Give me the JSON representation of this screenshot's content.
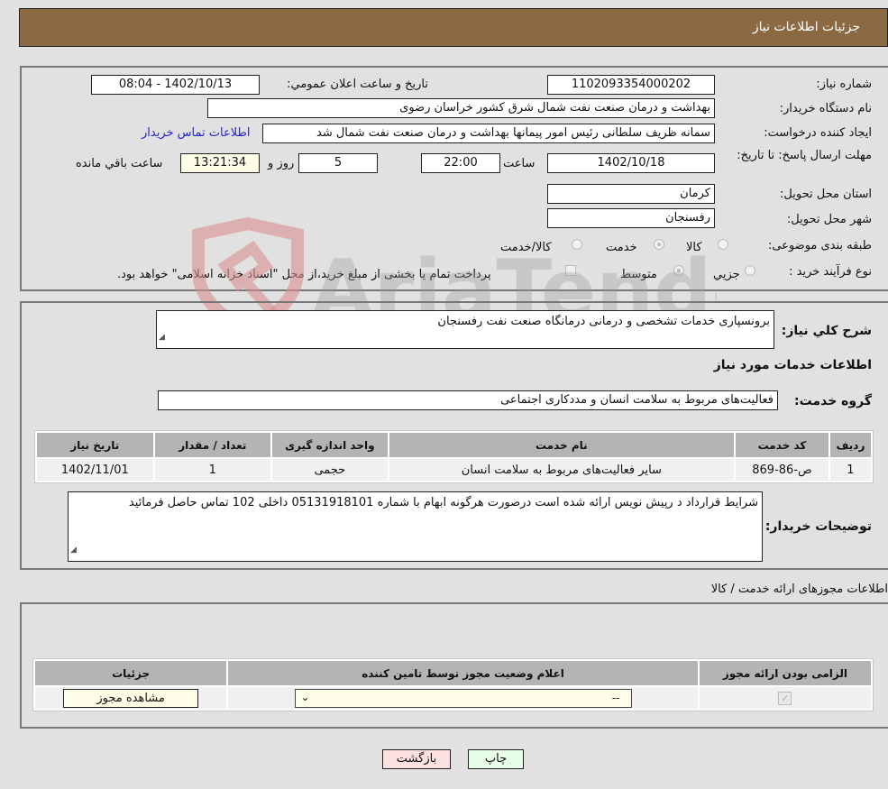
{
  "header": {
    "title": "جزئیات اطلاعات نیاز"
  },
  "form": {
    "need_number": {
      "label": "شماره نیاز:",
      "value": "1102093354000202"
    },
    "announce_datetime": {
      "label": "تاریخ و ساعت اعلان عمومي:",
      "value": "1402/10/13 - 08:04"
    },
    "buyer_org": {
      "label": "نام دستگاه خريدار:",
      "value": "بهداشت و درمان صنعت نفت شمال شرق کشور   خراسان رضوی"
    },
    "requester": {
      "label": "ايجاد کننده درخواست:",
      "value": "سمانه ظریف سلطانی رئیس امور پیمانها بهداشت و درمان صنعت نفت شمال شد"
    },
    "buyer_contact_link": "اطلاعات تماس خريدار",
    "deadline": {
      "label": "مهلت ارسال پاسخ: تا تاريخ:",
      "date": "1402/10/18",
      "time_label": "ساعت",
      "time": "22:00",
      "days": "5",
      "days_label": "روز و",
      "remaining": "13:21:34",
      "remaining_label": "ساعت باقي مانده"
    },
    "province": {
      "label": "استان محل تحويل:",
      "value": "کرمان"
    },
    "city": {
      "label": "شهر محل تحويل:",
      "value": "رفسنجان"
    },
    "category": {
      "label": "طبقه بندی موضوعی:",
      "options": [
        "کالا",
        "خدمت",
        "کالا/خدمت"
      ],
      "selected": "خدمت"
    },
    "purchase_type": {
      "label": "نوع فرآيند خريد :",
      "options": [
        "جزيي",
        "متوسط"
      ],
      "selected": "متوسط",
      "note": "پرداخت تمام يا بخشی از مبلغ خريد،از محل \"اسناد خزانه اسلامی\" خواهد بود."
    }
  },
  "description": {
    "label": "شرح کلي نياز:",
    "value": "برونسپاری خدمات تشخصی و درمانی درمانگاه صنعت نفت رفسنجان"
  },
  "services_section_title": "اطلاعات خدمات مورد نياز",
  "service_group": {
    "label": "گروه خدمت:",
    "value": "فعاليت‌های مربوط به سلامت انسان و مددکاری اجتماعی"
  },
  "services_table": {
    "headers": [
      "رديف",
      "کد خدمت",
      "نام خدمت",
      "واحد اندازه گيری",
      "تعداد / مقدار",
      "تاريخ نياز"
    ],
    "rows": [
      [
        "1",
        "ص-86-869",
        "ساير فعاليت‌های مربوط به سلامت انسان",
        "حجمی",
        "1",
        "1402/11/01"
      ]
    ]
  },
  "buyer_notes": {
    "label": "توضيحات خريدار:",
    "value": "شرایط قرارداد د رپیش نویس ارائه شده است درصورت هرگونه ابهام با شماره 05131918101 داخلی 102 تماس حاصل فرمائید"
  },
  "permits_section_title": "اطلاعات مجوزهای ارائه خدمت / کالا",
  "permits_table": {
    "headers": [
      "الزامی بودن ارائه مجوز",
      "اعلام وضعيت مجوز توسط تامين کننده",
      "جزئيات"
    ],
    "rows": [
      {
        "required": true,
        "status": "--",
        "details_button": "مشاهده مجوز"
      }
    ]
  },
  "actions": {
    "print": "چاپ",
    "back": "بازگشت"
  },
  "watermark": "AriaTender.neT",
  "colors": {
    "header_bg": "#8b6a43",
    "back_btn": "#fde0e0",
    "print_btn": "#e8fde8",
    "link": "#2222cc"
  }
}
